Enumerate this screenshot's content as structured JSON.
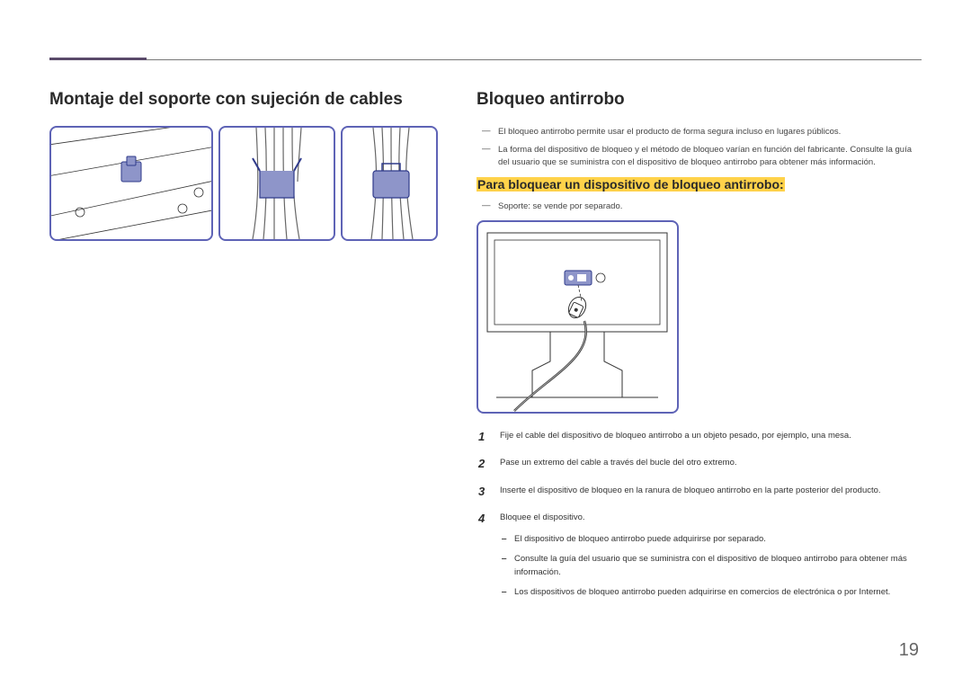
{
  "left": {
    "title": "Montaje del soporte con sujeción de cables"
  },
  "right": {
    "title": "Bloqueo antirrobo",
    "notes": [
      "El bloqueo antirrobo permite usar el producto de forma segura incluso en lugares públicos.",
      "La forma del dispositivo de bloqueo y el método de bloqueo varían en función del fabricante. Consulte la guía del usuario que se suministra con el dispositivo de bloqueo antirrobo para obtener más información."
    ],
    "sub_heading": "Para bloquear un dispositivo de bloqueo antirrobo:",
    "support_note": "Soporte: se vende por separado.",
    "steps": [
      "Fije el cable del dispositivo de bloqueo antirrobo a un objeto pesado, por ejemplo, una mesa.",
      "Pase un extremo del cable a través del bucle del otro extremo.",
      "Inserte el dispositivo de bloqueo en la ranura de bloqueo antirrobo en la parte posterior del producto.",
      "Bloquee el dispositivo."
    ],
    "sub_bullets": [
      "El dispositivo de bloqueo antirrobo puede adquirirse por separado.",
      "Consulte la guía del usuario que se suministra con el dispositivo de bloqueo antirrobo para obtener más información.",
      "Los dispositivos de bloqueo antirrobo pueden adquirirse en comercios de electrónica o por Internet."
    ]
  },
  "page_number": "19"
}
